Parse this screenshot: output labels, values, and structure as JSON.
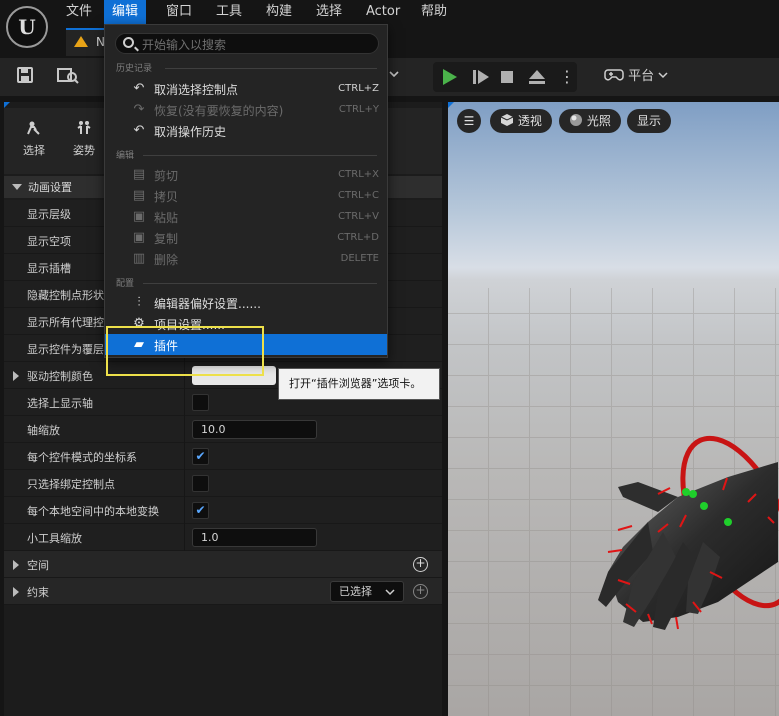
{
  "menubar": {
    "logo": "U",
    "items": [
      "文件",
      "编辑",
      "窗口",
      "工具",
      "构建",
      "选择",
      "Actor",
      "帮助"
    ]
  },
  "tab": {
    "label": "N"
  },
  "toolbar": {
    "platform_label": "平台"
  },
  "left_panel": {
    "tools": [
      {
        "label": "选择"
      },
      {
        "label": "姿势"
      }
    ],
    "section_title": "动画设置",
    "rows": [
      {
        "label": "显示层级"
      },
      {
        "label": "显示空项"
      },
      {
        "label": "显示插槽"
      },
      {
        "label": "隐藏控制点形状"
      },
      {
        "label": "显示所有代理控"
      },
      {
        "label": "显示控件为覆层"
      },
      {
        "label": "驱动控制颜色"
      },
      {
        "label": "选择上显示轴",
        "checked": false
      },
      {
        "label": "轴缩放",
        "value": "10.0"
      },
      {
        "label": "每个控件模式的坐标系",
        "checked": true
      },
      {
        "label": "只选择绑定控制点",
        "checked": false
      },
      {
        "label": "每个本地空间中的本地变换",
        "checked": true
      },
      {
        "label": "小工具缩放",
        "value": "1.0"
      }
    ],
    "categories": [
      {
        "label": "空间"
      },
      {
        "label": "约束",
        "select_value": "已选择"
      }
    ]
  },
  "viewport": {
    "buttons": [
      "透视",
      "光照",
      "显示"
    ]
  },
  "edit_menu": {
    "search_placeholder": "开始输入以搜索",
    "sections": [
      {
        "header": "历史记录",
        "items": [
          {
            "label": "取消选择控制点",
            "shortcut": "CTRL+Z",
            "icon": "undo-icon",
            "disabled": false
          },
          {
            "label": "恢复(没有要恢复的内容)",
            "shortcut": "CTRL+Y",
            "icon": "redo-icon",
            "disabled": true
          },
          {
            "label": "取消操作历史",
            "shortcut": "",
            "icon": "history-icon",
            "disabled": false
          }
        ]
      },
      {
        "header": "编辑",
        "items": [
          {
            "label": "剪切",
            "shortcut": "CTRL+X",
            "icon": "cut-icon",
            "disabled": true
          },
          {
            "label": "拷贝",
            "shortcut": "CTRL+C",
            "icon": "copy-icon",
            "disabled": true
          },
          {
            "label": "粘贴",
            "shortcut": "CTRL+V",
            "icon": "paste-icon",
            "disabled": true
          },
          {
            "label": "复制",
            "shortcut": "CTRL+D",
            "icon": "duplicate-icon",
            "disabled": true
          },
          {
            "label": "删除",
            "shortcut": "DELETE",
            "icon": "trash-icon",
            "disabled": true
          }
        ]
      },
      {
        "header": "配置",
        "items": [
          {
            "label": "编辑器偏好设置......",
            "shortcut": "",
            "icon": "sliders-icon",
            "disabled": false
          },
          {
            "label": "项目设置......",
            "shortcut": "",
            "icon": "gear-icon",
            "disabled": false
          },
          {
            "label": "插件",
            "shortcut": "",
            "icon": "plugin-icon",
            "disabled": false,
            "highlighted": true
          }
        ]
      }
    ]
  },
  "tooltip": {
    "text": "打开“插件浏览器”选项卡。"
  },
  "colors": {
    "accent": "#0f70d6",
    "highlight_box": "#ede04a"
  }
}
